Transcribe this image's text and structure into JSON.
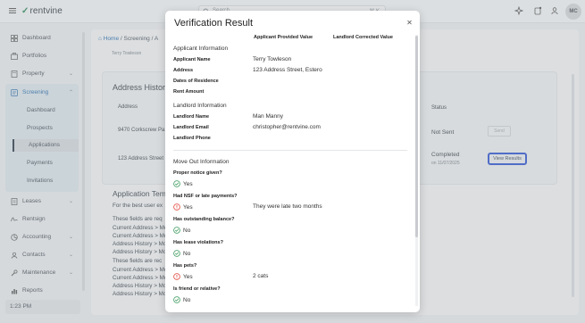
{
  "topbar": {
    "logo": "rentvine",
    "search_placeholder": "Search",
    "search_shortcut": "⌘ K",
    "avatar_initials": "MC"
  },
  "sidebar": {
    "items": [
      {
        "label": "Dashboard"
      },
      {
        "label": "Portfolios"
      },
      {
        "label": "Property"
      },
      {
        "label": "Screening"
      },
      {
        "label": "Leases"
      },
      {
        "label": "Rentsign"
      },
      {
        "label": "Accounting"
      },
      {
        "label": "Contacts"
      },
      {
        "label": "Maintenance"
      },
      {
        "label": "Reports"
      }
    ],
    "screening_sub": [
      {
        "label": "Dashboard"
      },
      {
        "label": "Prospects"
      },
      {
        "label": "Applications"
      },
      {
        "label": "Payments"
      },
      {
        "label": "Invitations"
      }
    ],
    "footer_time": "1:23 PM"
  },
  "background": {
    "breadcrumb": {
      "home": "Home",
      "sep": "/",
      "screening": "Screening",
      "next": "A"
    },
    "applicant_tag": "Terry Towleson",
    "card_title": "Address History",
    "col_address": "Address",
    "col_status": "Status",
    "rows": [
      {
        "address": "9470 Corkscrew Pa",
        "status": "Not Sent",
        "action": "Send"
      },
      {
        "address": "123 Address Street",
        "status": "Completed",
        "date": "on 11/07/2025",
        "action": "View Results"
      }
    ],
    "app_template_title": "Application Temp",
    "lines": [
      "For the best user ex",
      "These fields are req",
      "Current Address > Mo",
      "Current Address > Mo",
      "Address History > Mo",
      "Address History > Mo",
      "These fields are rec",
      "Current Address > Mo",
      "Current Address > Mo",
      "Address History > Mo",
      "Address History > Mo"
    ]
  },
  "modal": {
    "title": "Verification Result",
    "col_provided": "Applicant Provided Value",
    "col_corrected": "Landlord Corrected Value",
    "applicant_section": "Applicant Information",
    "applicant_fields": [
      {
        "label": "Applicant Name",
        "value": "Terry Towleson"
      },
      {
        "label": "Address",
        "value": "123 Address Street, Estero"
      },
      {
        "label": "Dates of Residence",
        "value": ""
      },
      {
        "label": "Rent Amount",
        "value": ""
      }
    ],
    "landlord_section": "Landlord Information",
    "landlord_fields": [
      {
        "label": "Landlord Name",
        "value": "Man Manny"
      },
      {
        "label": "Landlord Email",
        "value": "christopher@rentvine.com"
      },
      {
        "label": "Landlord Phone",
        "value": ""
      }
    ],
    "moveout_section": "Move Out Information",
    "questions": [
      {
        "q": "Proper notice given?",
        "a": "Yes",
        "kind": "ok",
        "note": ""
      },
      {
        "q": "Had NSF or late payments?",
        "a": "Yes",
        "kind": "warn",
        "note": "They were late two months"
      },
      {
        "q": "Has outstanding balance?",
        "a": "No",
        "kind": "ok",
        "note": ""
      },
      {
        "q": "Has lease violations?",
        "a": "No",
        "kind": "ok",
        "note": ""
      },
      {
        "q": "Has pets?",
        "a": "Yes",
        "kind": "warn",
        "note": "2 cats"
      },
      {
        "q": "Is friend or relative?",
        "a": "No",
        "kind": "ok",
        "note": ""
      }
    ],
    "colors": {
      "ok": "#3a9a5c",
      "warn": "#e0453a",
      "focus": "#2f55d4"
    }
  }
}
